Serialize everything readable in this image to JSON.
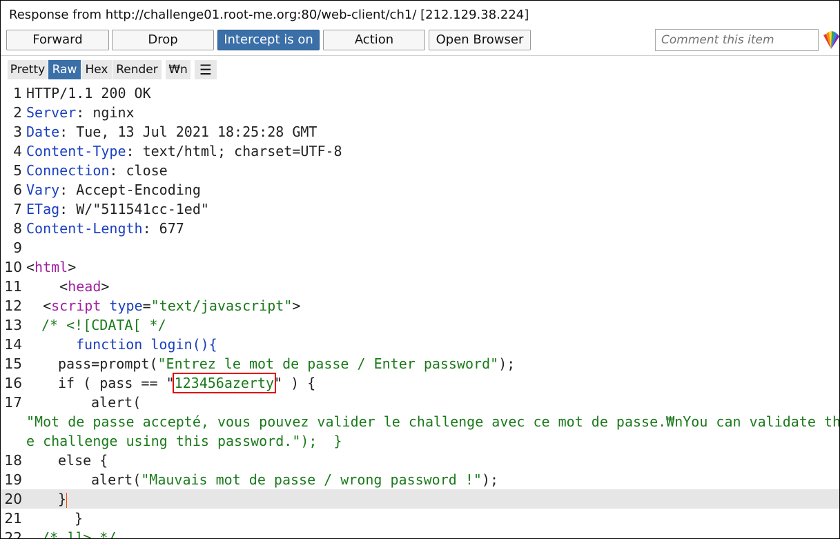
{
  "window": {
    "title": "Response from http://challenge01.root-me.org:80/web-client/ch1/  [212.129.38.224]"
  },
  "toolbar": {
    "forward": "Forward",
    "drop": "Drop",
    "intercept": "Intercept is on",
    "action": "Action",
    "open_browser": "Open Browser",
    "comment_placeholder": "Comment this item"
  },
  "tabs": [
    "Pretty",
    "Raw",
    "Hex",
    "Render",
    "₩n",
    "☰"
  ],
  "active_tab": "Raw",
  "highlight_color": "#e00000",
  "editor": {
    "lines": {
      "l1": "HTTP/1.1 200 OK",
      "l2_key": "Server",
      "l2_val": ": nginx",
      "l3_key": "Date",
      "l3_val": ": Tue, 13 Jul 2021 18:25:28 GMT",
      "l4_key": "Content-Type",
      "l4_val": ": text/html; charset=UTF-8",
      "l5_key": "Connection",
      "l5_val": ": close",
      "l6_key": "Vary",
      "l6_val": ": Accept-Encoding",
      "l7_key": "ETag",
      "l7_val": ": W/\"511541cc-1ed\"",
      "l8_key": "Content-Length",
      "l8_val": ": 677",
      "l10_tag": "html",
      "l11_tag": "head",
      "l12_tag": "script",
      "l12_attr": "type",
      "l12_val": "\"text/javascript\"",
      "l13": "/* <![CDATA[ */",
      "l14": "function login(){",
      "l15_pre": "pass=prompt(",
      "l15_str": "\"Entrez le mot de passe / Enter password\"",
      "l15_post": ");",
      "l16_pre": "if ( pass == \"",
      "l16_pw": "123456azerty",
      "l16_post": "\" ) {",
      "l17": "alert(",
      "l17_wrap1": "\"Mot de passe accepté, vous pouvez valider le challenge avec ce mot de passe.₩nYou can validate th",
      "l17_wrap2": "e challenge using this password.\");  }",
      "l18": "else {",
      "l19_pre": "alert(",
      "l19_str": "\"Mauvais mot de passe / wrong password !\"",
      "l19_post": ");",
      "l20": "}",
      "l21": "}",
      "l22": "/* ]]> */"
    }
  }
}
